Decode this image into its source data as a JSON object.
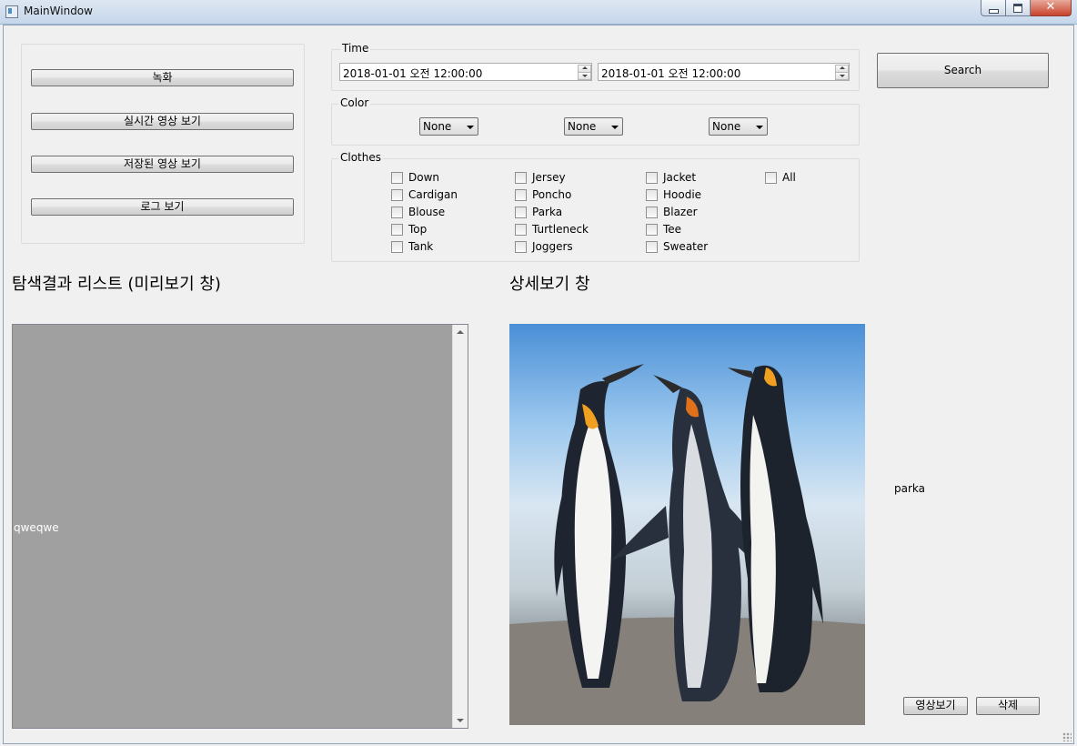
{
  "window": {
    "title": "MainWindow",
    "close_glyph": "✕"
  },
  "nav_buttons": [
    "녹화",
    "실시간 영상 보기",
    "저장된 영상 보기",
    "로그 보기"
  ],
  "time": {
    "label": "Time",
    "start": "2018-01-01 오전 12:00:00",
    "end": "2018-01-01 오전 12:00:00"
  },
  "color": {
    "label": "Color",
    "selects": [
      "None",
      "None",
      "None"
    ]
  },
  "clothes": {
    "label": "Clothes",
    "columns": [
      [
        "Down",
        "Cardigan",
        "Blouse",
        "Top",
        "Tank"
      ],
      [
        "Jersey",
        "Poncho",
        "Parka",
        "Turtleneck",
        "Joggers"
      ],
      [
        "Jacket",
        "Hoodie",
        "Blazer",
        "Tee",
        "Sweater"
      ],
      [
        "All"
      ]
    ]
  },
  "search_button": "Search",
  "results": {
    "heading": "탐색결과 리스트 (미리보기 창)",
    "items": [
      "qweqwe"
    ]
  },
  "detail": {
    "heading": "상세보기 창",
    "image": "penguins-image",
    "label": "parka",
    "play_button": "영상보기",
    "delete_button": "삭제"
  },
  "icons": {
    "app": "app-window-icon",
    "minimize": "minimize-icon",
    "maximize": "maximize-icon",
    "close": "close-icon",
    "spin": "spin-arrows-icon",
    "dropdown": "chevron-down-icon",
    "resize": "resize-grip-icon"
  }
}
